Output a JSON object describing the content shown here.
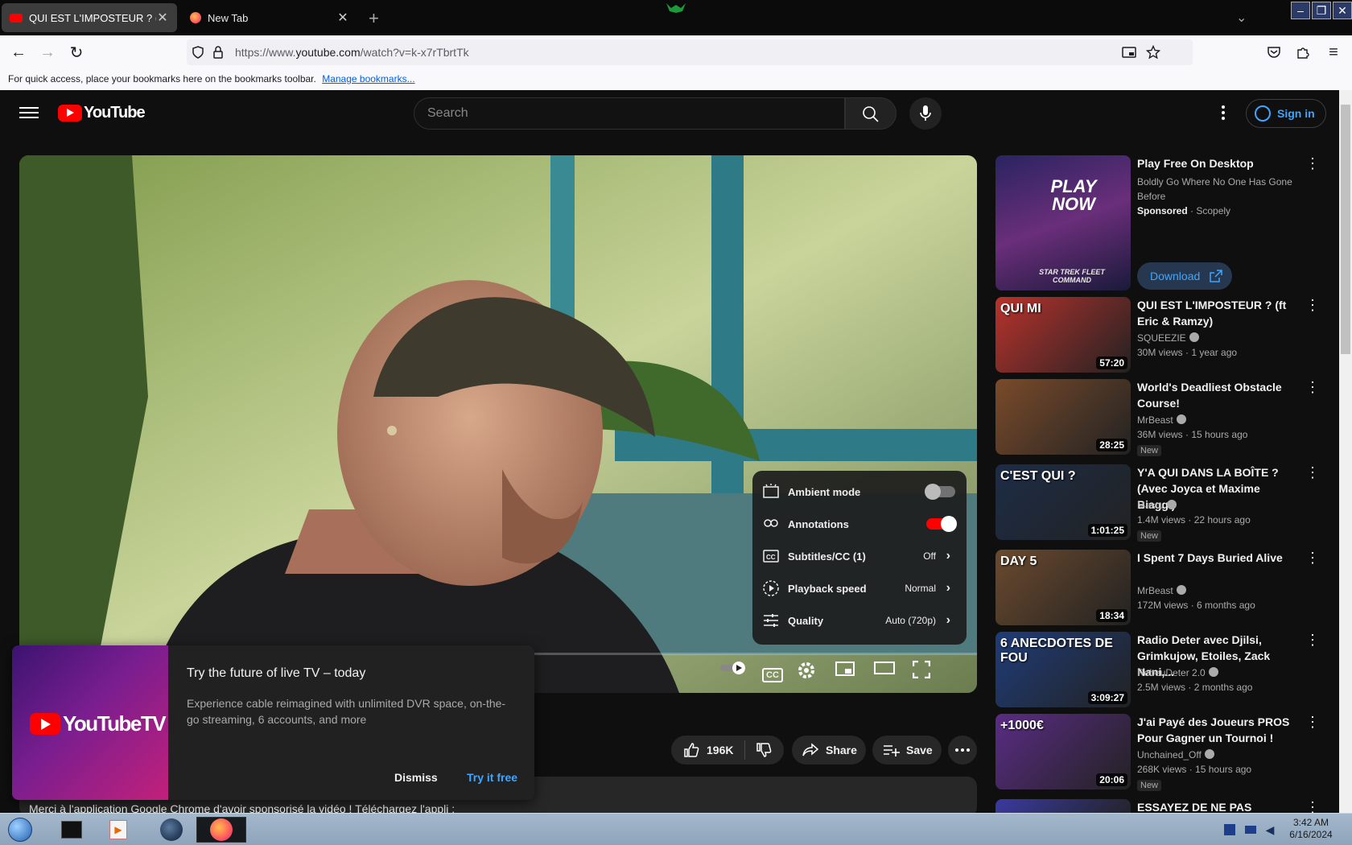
{
  "browser": {
    "tabs": [
      {
        "title": "QUI EST L'IMPOSTEUR ? (ft Omar",
        "close": "✕"
      },
      {
        "title": "New Tab",
        "close": "✕"
      }
    ],
    "new_tab": "+",
    "url_prefix": "https://www.",
    "url_domain": "youtube.com",
    "url_path": "/watch?v=k-x7rTbrtTk",
    "bookmarks_text": "For quick access, place your bookmarks here on the bookmarks toolbar.",
    "bookmarks_link": "Manage bookmarks..."
  },
  "header": {
    "logo_text": "YouTube",
    "search_placeholder": "Search",
    "signin_label": "Sign in"
  },
  "player": {
    "progress": 0.0,
    "settings": {
      "ambient_label": "Ambient mode",
      "ambient_on": false,
      "annotations_label": "Annotations",
      "annotations_on": true,
      "subtitles_label": "Subtitles/CC (1)",
      "subtitles_value": "Off",
      "speed_label": "Playback speed",
      "speed_value": "Normal",
      "quality_label": "Quality",
      "quality_value": "Auto (720p)"
    },
    "cc_label": "CC"
  },
  "actions": {
    "likes": "196K",
    "share": "Share",
    "save": "Save"
  },
  "description": {
    "text": "Merci à l'application Google Chrome d'avoir sponsorisé la vidéo ! Téléchargez l'appli :"
  },
  "promo": {
    "logo_text": "YouTubeTV",
    "title": "Try the future of live TV – today",
    "body": "Experience cable reimagined with unlimited DVR space, on-the-go streaming, 6 accounts, and more",
    "dismiss": "Dismiss",
    "try": "Try it free"
  },
  "sidebar": {
    "ad": {
      "title": "Play Free On Desktop",
      "subtitle": "Boldly Go Where No One Has Gone Before",
      "sponsored": "Sponsored",
      "advertiser": "Scopely",
      "download": "Download",
      "thumb_text": "PLAY NOW",
      "thumb_sub": "STAR TREK FLEET COMMAND",
      "accent": "#3ea6ff"
    },
    "videos": [
      {
        "title": "QUI EST L'IMPOSTEUR ? (ft Eric & Ramzy)",
        "channel": "SQUEEZIE",
        "views": "30M views",
        "age": "1 year ago",
        "duration": "57:20",
        "new": "",
        "overlay": "QUI MI",
        "color": "#b8322c"
      },
      {
        "title": "World's Deadliest Obstacle Course!",
        "channel": "MrBeast",
        "views": "36M views",
        "age": "15 hours ago",
        "duration": "28:25",
        "new": "New",
        "overlay": "",
        "color": "#7a4b2a"
      },
      {
        "title": "Y'A QUI DANS LA BOÎTE ? (Avec Joyca et Maxime Biaggi)",
        "channel": "Mastu",
        "views": "1.4M views",
        "age": "22 hours ago",
        "duration": "1:01:25",
        "new": "New",
        "overlay": "C'EST QUI ?",
        "color": "#1d2c46"
      },
      {
        "title": "I Spent 7 Days Buried Alive",
        "channel": "MrBeast",
        "views": "172M views",
        "age": "6 months ago",
        "duration": "18:34",
        "new": "",
        "overlay": "DAY 5",
        "color": "#6b4a2e"
      },
      {
        "title": "Radio Deter avec Djilsi, Grimkujow, Etoiles, Zack Nani,...",
        "channel": "RebeuDeter 2.0",
        "views": "2.5M views",
        "age": "2 months ago",
        "duration": "3:09:27",
        "new": "",
        "overlay": "6 ANECDOTES DE FOU",
        "color": "#1f3c78"
      },
      {
        "title": "J'ai Payé des Joueurs PROS Pour Gagner un Tournoi !",
        "channel": "Unchained_Off",
        "views": "268K views",
        "age": "15 hours ago",
        "duration": "20:06",
        "new": "New",
        "overlay": "+1000€",
        "color": "#5a2c84"
      },
      {
        "title": "ESSAYEZ DE NE PAS RÉAGIR",
        "channel": "",
        "views": "",
        "age": "",
        "duration": "",
        "new": "",
        "overlay": "",
        "color": "#3a3aa0"
      }
    ]
  },
  "taskbar": {
    "time": "3:42 AM",
    "date": "6/16/2024"
  }
}
